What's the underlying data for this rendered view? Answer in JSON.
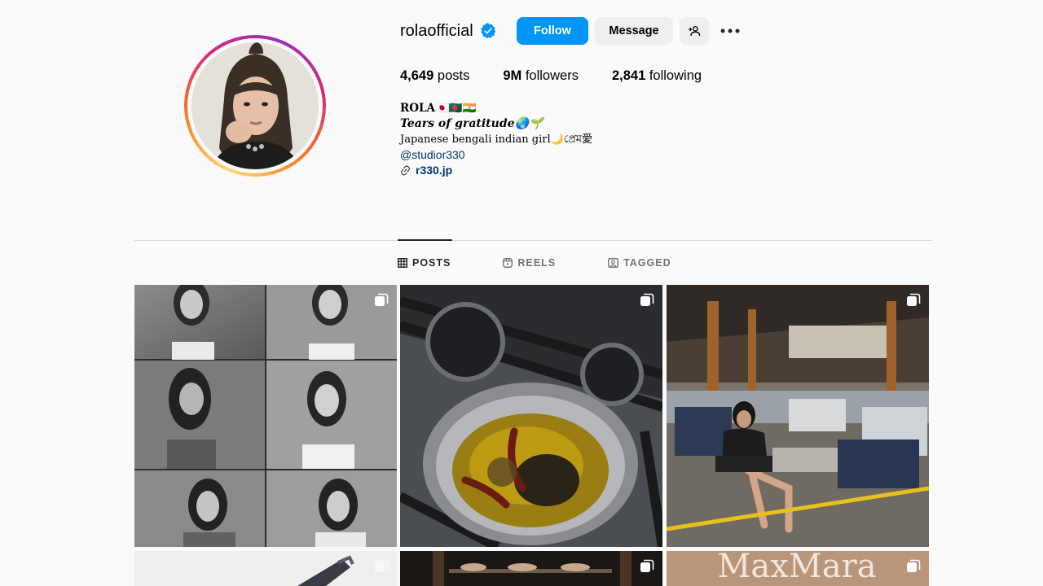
{
  "profile": {
    "username": "rolaofficial",
    "verified": true,
    "follow_label": "Follow",
    "message_label": "Message",
    "stats": {
      "posts_count": "4,649",
      "posts_label": "posts",
      "followers_count": "9M",
      "followers_label": "followers",
      "following_count": "2,841",
      "following_label": "following"
    },
    "bio": {
      "name": "ROLA🇯🇵🇧🇩🇮🇳",
      "tagline": "Tears of gratitude🌏🌱",
      "description": "Japanese bengali indian girl🌙প্রেম愛",
      "mention": "@studior330",
      "link": "r330.jp"
    }
  },
  "tabs": [
    {
      "label": "POSTS",
      "icon": "grid-icon",
      "active": true
    },
    {
      "label": "REELS",
      "icon": "reels-icon",
      "active": false
    },
    {
      "label": "TAGGED",
      "icon": "tagged-icon",
      "active": false
    }
  ],
  "posts": [
    {
      "type": "carousel",
      "subject": "black-and-white portrait collage"
    },
    {
      "type": "carousel",
      "subject": "spices in pan on stove"
    },
    {
      "type": "carousel",
      "subject": "woman in factory"
    },
    {
      "type": "carousel",
      "subject": "magazine cover"
    },
    {
      "type": "carousel",
      "subject": "shoe display"
    },
    {
      "type": "carousel",
      "subject": "MaxMara"
    }
  ],
  "colors": {
    "accent": "#0095f6",
    "link": "#00376b",
    "verified": "#0095f6"
  },
  "post_texts": {
    "maxmara": "MaxMara"
  }
}
